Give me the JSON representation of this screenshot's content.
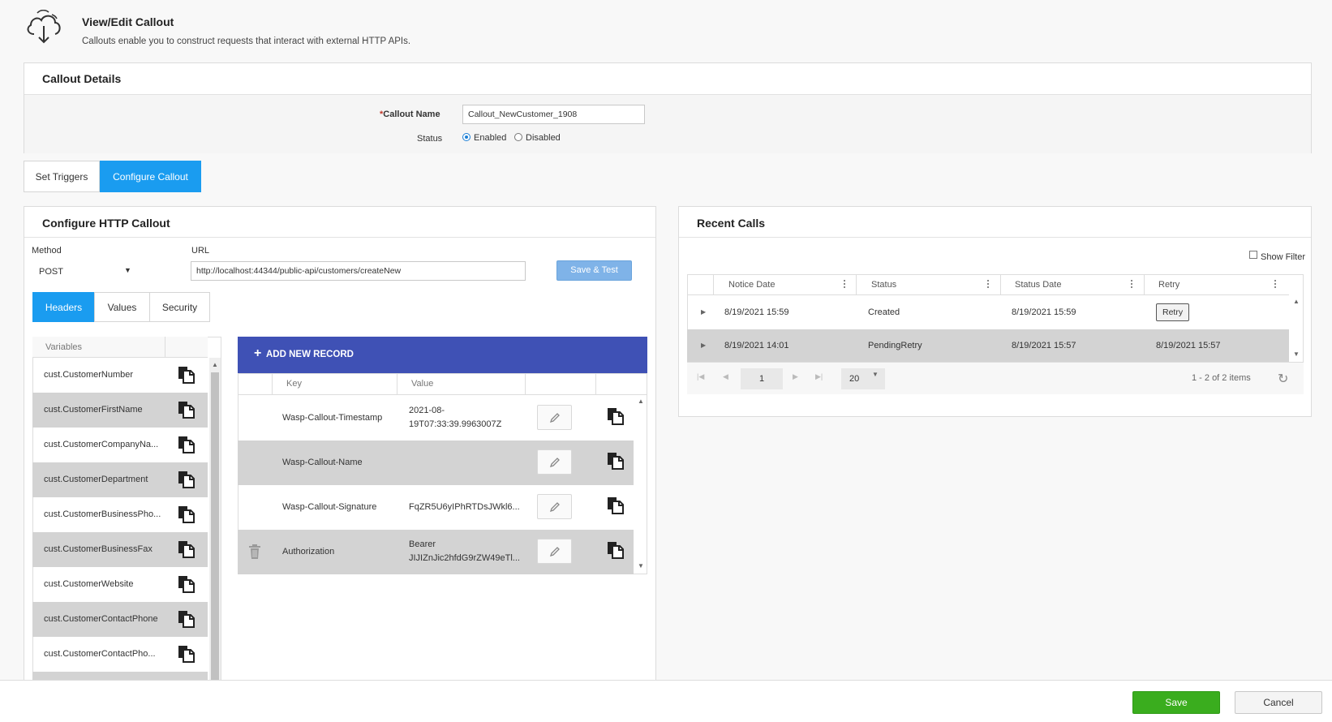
{
  "header": {
    "title": "View/Edit Callout",
    "subtitle": "Callouts enable you to construct requests that interact with external HTTP APIs.",
    "icon": "cloud-download-icon"
  },
  "callout_details": {
    "title": "Callout Details",
    "name_label": "Callout Name",
    "name_required_mark": "*",
    "name_value": "Callout_NewCustomer_1908",
    "status_label": "Status",
    "status_options": [
      "Enabled",
      "Disabled"
    ],
    "status_selected": "Enabled"
  },
  "main_tabs": [
    {
      "label": "Set Triggers",
      "active": false
    },
    {
      "label": "Configure Callout",
      "active": true
    }
  ],
  "http_callout": {
    "title": "Configure HTTP Callout",
    "method_label": "Method",
    "method_value": "POST",
    "url_label": "URL",
    "url_value": "http://localhost:44344/public-api/customers/createNew",
    "save_test_label": "Save & Test",
    "sub_tabs": [
      {
        "label": "Headers",
        "active": true
      },
      {
        "label": "Values",
        "active": false
      },
      {
        "label": "Security",
        "active": false
      }
    ],
    "variables_header": "Variables",
    "variables": [
      "cust.CustomerNumber",
      "cust.CustomerFirstName",
      "cust.CustomerCompanyNa...",
      "cust.CustomerDepartment",
      "cust.CustomerBusinessPho...",
      "cust.CustomerBusinessFax",
      "cust.CustomerWebsite",
      "cust.CustomerContactPhone",
      "cust.CustomerContactPho..."
    ],
    "add_record_label": "ADD NEW RECORD",
    "records_columns": [
      "Key",
      "Value"
    ],
    "records": [
      {
        "key": "Wasp-Callout-Timestamp",
        "value_line1": "2021-08-",
        "value_line2": "19T07:33:39.9963007Z",
        "deletable": false
      },
      {
        "key": "Wasp-Callout-Name",
        "value_line1": "",
        "value_line2": "",
        "deletable": false
      },
      {
        "key": "Wasp-Callout-Signature",
        "value_line1": "FqZR5U6yIPhRTDsJWkl6...",
        "value_line2": "",
        "deletable": false
      },
      {
        "key": "Authorization",
        "value_line1": "Bearer",
        "value_line2": "JIJIZnJic2hfdG9rZW49eTl...",
        "deletable": true
      }
    ]
  },
  "recent_calls": {
    "title": "Recent Calls",
    "show_filter_label": "Show Filter",
    "columns": [
      "Notice Date",
      "Status",
      "Status Date",
      "Retry"
    ],
    "rows": [
      {
        "notice_date": "8/19/2021 15:59",
        "status": "Created",
        "status_date": "8/19/2021 15:59",
        "retry": "Retry"
      },
      {
        "notice_date": "8/19/2021 14:01",
        "status": "PendingRetry",
        "status_date": "8/19/2021 15:57",
        "retry": "8/19/2021 15:57"
      }
    ],
    "pager": {
      "page": "1",
      "page_size": "20",
      "summary": "1 - 2 of 2 items"
    }
  },
  "footer": {
    "save_label": "Save",
    "cancel_label": "Cancel"
  },
  "colors": {
    "accent": "#1a9cf0",
    "add_record_bar": "#3f51b5",
    "save": "#3aad1e"
  }
}
